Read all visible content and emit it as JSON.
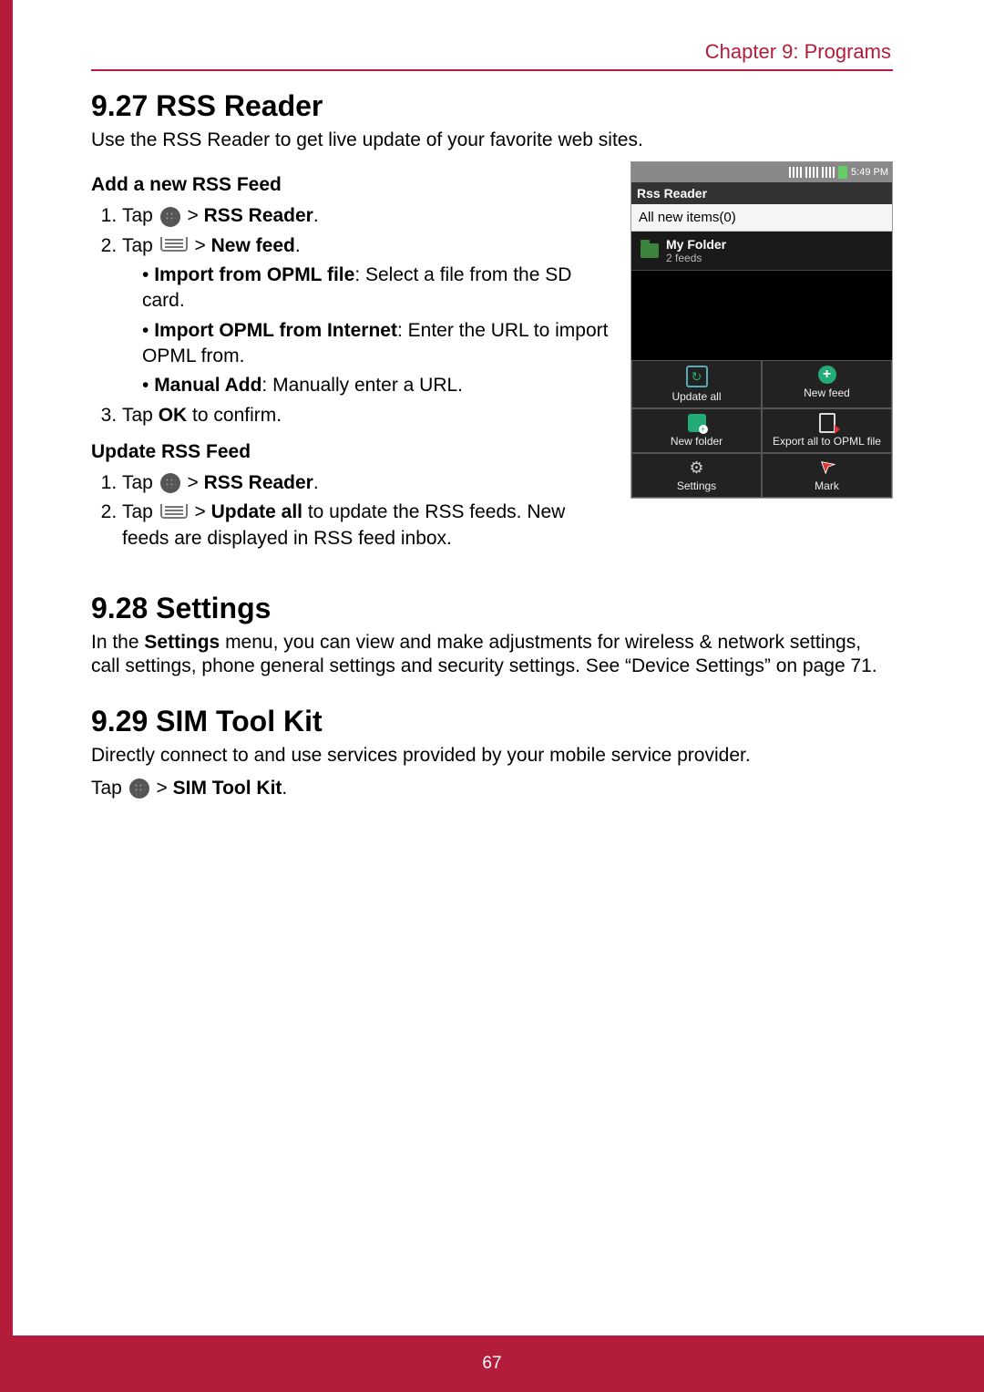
{
  "header": {
    "chapter": "Chapter 9: Programs"
  },
  "footer": {
    "page_number": "67"
  },
  "s927": {
    "heading": "9.27 RSS Reader",
    "intro": "Use the RSS Reader to get live update of your favorite web sites.",
    "add": {
      "subhead": "Add a new RSS Feed",
      "step1_pre": "Tap ",
      "step1_post": " > ",
      "step1_bold": "RSS Reader",
      "step1_end": ".",
      "step2_pre": "Tap ",
      "step2_post": " > ",
      "step2_bold": "New feed",
      "step2_end": ".",
      "b1_bold": "Import from OPML file",
      "b1_rest": ": Select a file from the SD card.",
      "b2_bold": "Import OPML from Internet",
      "b2_rest": ": Enter the URL to import OPML from.",
      "b3_bold": "Manual Add",
      "b3_rest": ": Manually enter a URL.",
      "step3_pre": "Tap ",
      "step3_bold": "OK",
      "step3_rest": " to confirm."
    },
    "upd": {
      "subhead": "Update RSS Feed",
      "step1_pre": "Tap ",
      "step1_post": " > ",
      "step1_bold": "RSS Reader",
      "step1_end": ".",
      "step2_pre": "Tap ",
      "step2_post": " > ",
      "step2_bold": "Update all",
      "step2_rest": " to update the RSS feeds. New feeds are displayed in RSS feed inbox."
    }
  },
  "phone": {
    "time": "5:49 PM",
    "title": "Rss Reader",
    "all_items": "All new items(0)",
    "folder_name": "My Folder",
    "folder_sub": "2 feeds",
    "menu": {
      "update_all": "Update all",
      "new_feed": "New feed",
      "new_folder": "New folder",
      "export": "Export all to OPML file",
      "settings": "Settings",
      "mark": "Mark"
    }
  },
  "s928": {
    "heading": "9.28 Settings",
    "p_pre": "In the ",
    "p_bold": "Settings",
    "p_rest": " menu, you can view and make adjustments for wireless & network settings, call settings, phone general settings and security settings. See “Device Settings” on page 71."
  },
  "s929": {
    "heading": "9.29 SIM Tool Kit",
    "intro": "Directly connect to and use services provided by your mobile service provider.",
    "tap_pre": "Tap ",
    "tap_post": " > ",
    "tap_bold": "SIM Tool Kit",
    "tap_end": "."
  }
}
